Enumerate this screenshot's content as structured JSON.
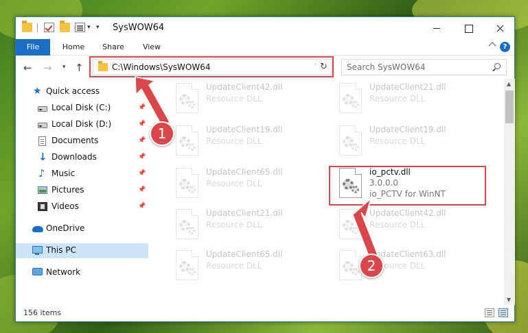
{
  "window": {
    "title": "SysWOW64"
  },
  "ribbon": {
    "tabs": [
      "File",
      "Home",
      "Share",
      "View"
    ],
    "help": "?"
  },
  "nav": {
    "address": "C:\\Windows\\SysWOW64",
    "search_placeholder": "Search SysWOW64"
  },
  "sidebar": {
    "items": [
      {
        "label": "Quick access",
        "icon": "quick-access-star-icon",
        "pinned": false
      },
      {
        "label": "Local Disk (C:)",
        "icon": "local-disk-icon",
        "pinned": true
      },
      {
        "label": "Local Disk (D:)",
        "icon": "local-disk-icon",
        "pinned": true
      },
      {
        "label": "Documents",
        "icon": "documents-icon",
        "pinned": true
      },
      {
        "label": "Downloads",
        "icon": "downloads-icon",
        "pinned": true
      },
      {
        "label": "Music",
        "icon": "music-icon",
        "pinned": true
      },
      {
        "label": "Pictures",
        "icon": "pictures-icon",
        "pinned": true
      },
      {
        "label": "Videos",
        "icon": "videos-icon",
        "pinned": true
      },
      {
        "label": "OneDrive",
        "icon": "onedrive-icon",
        "pinned": false
      },
      {
        "label": "This PC",
        "icon": "this-pc-icon",
        "pinned": false,
        "selected": true
      },
      {
        "label": "Network",
        "icon": "network-icon",
        "pinned": false
      }
    ]
  },
  "files": [
    {
      "name": "UpdateClient42.dll",
      "sub": "Resource DLL",
      "faded": true
    },
    {
      "name": "UpdateClient21.dll",
      "sub": "Resource DLL",
      "faded": true
    },
    {
      "name": "UpdateClient19.dll",
      "sub": "Resource DLL",
      "faded": true
    },
    {
      "name": "UpdateClient19.dll",
      "sub": "Resource DLL",
      "faded": true
    },
    {
      "name": "UpdateClient65.dll",
      "sub": "Resource DLL",
      "faded": true
    },
    {
      "name": "io_pctv.dll",
      "version": "3.0.0.0",
      "sub": "io_PCTV for WinNT",
      "faded": false,
      "highlighted": true
    },
    {
      "name": "UpdateClient21.dll",
      "sub": "Resource DLL",
      "faded": true
    },
    {
      "name": "UpdateClient42.dll",
      "sub": "Resource DLL",
      "faded": true
    },
    {
      "name": "UpdateClient65.dll",
      "sub": "Resource DLL",
      "faded": true
    },
    {
      "name": "UpdateClient63.dll",
      "sub": "Resource DLL",
      "faded": true
    }
  ],
  "status": {
    "items_count": "156 items"
  },
  "annotations": {
    "badge1": "1",
    "badge2": "2",
    "color": "#d9474a"
  }
}
